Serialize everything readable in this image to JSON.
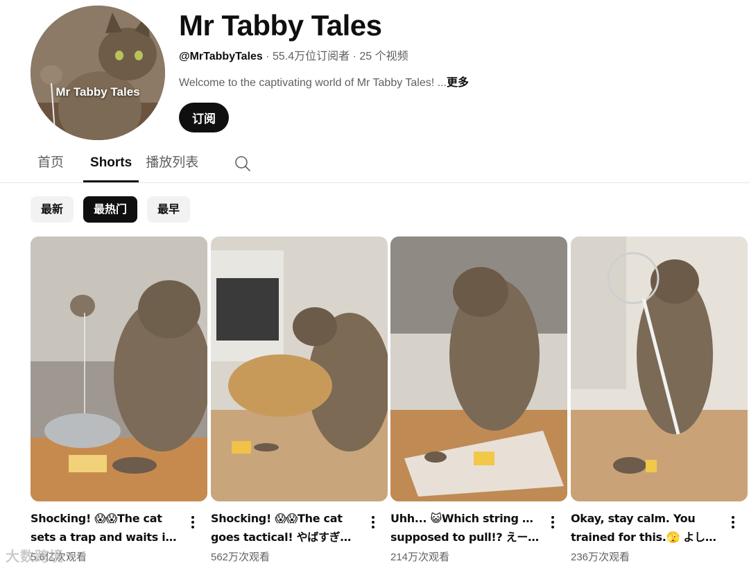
{
  "channel": {
    "avatar_text": "Mr Tabby Tales",
    "name": "Mr Tabby Tales",
    "handle": "@MrTabbyTales",
    "subscribers": "55.4万位订阅者",
    "videos": "25 个视频",
    "separator": " · ",
    "description": "Welcome to the captivating world of Mr Tabby Tales! ...",
    "more_label": "更多",
    "subscribe_label": "订阅"
  },
  "tabs": [
    {
      "label": "首页",
      "active": false
    },
    {
      "label": "Shorts",
      "active": true
    },
    {
      "label": "播放列表",
      "active": false
    }
  ],
  "search_icon": "search-icon",
  "chips": [
    {
      "label": "最新",
      "active": false
    },
    {
      "label": "最热门",
      "active": true
    },
    {
      "label": "最早",
      "active": false
    }
  ],
  "shorts": [
    {
      "title_line1": "Shocking! 😱😱The cat",
      "title_line2": "sets a trap and waits in ...",
      "views": "5.6亿次观看"
    },
    {
      "title_line1": "Shocking! 😱😱The cat",
      "title_line2": "goes tactical! やばすぎ！ ...",
      "views": "562万次观看"
    },
    {
      "title_line1": "Uhh... 😺Which string am I",
      "title_line2": "supposed to pull!? えーど...",
      "views": "214万次观看"
    },
    {
      "title_line1": "Okay, stay calm. You",
      "title_line2": "trained for this.🫣 よし、...",
      "views": "236万次观看"
    }
  ],
  "menu_icon": "more-vert-icon",
  "watermark": "大数跨境",
  "colors": {
    "text": "#0f0f0f",
    "secondary": "#606060",
    "chip_bg": "#f2f2f2",
    "divider": "#e5e5e5"
  }
}
